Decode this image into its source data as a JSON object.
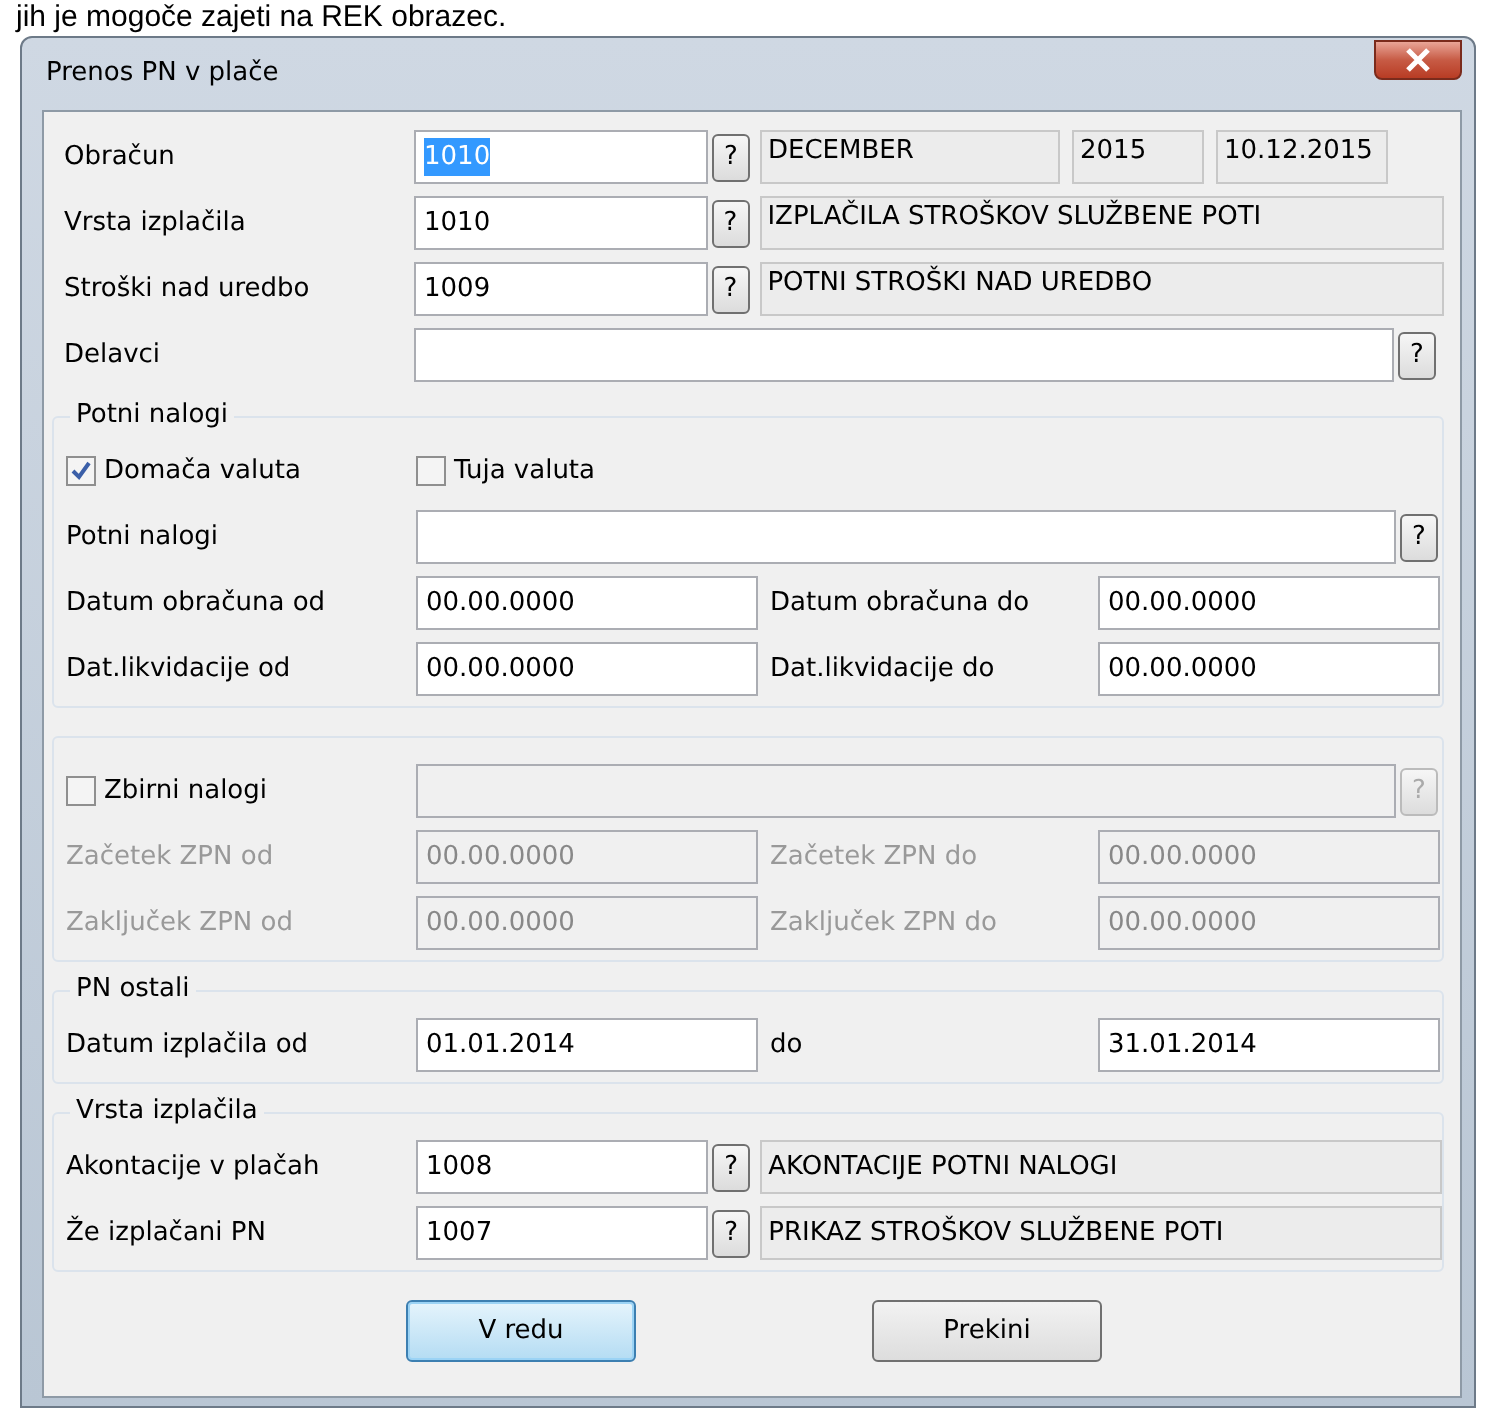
{
  "page_text": "jih je mogoče zajeti na REK obrazec.",
  "window": {
    "title": "Prenos PN v plače"
  },
  "main_rows": [
    {
      "label": "Obračun",
      "value": "1010",
      "value_selected": true,
      "lookup_button": "?",
      "infos": [
        "DECEMBER",
        "2015",
        "10.12.2015"
      ]
    },
    {
      "label": "Vrsta izplačila",
      "value": "1010",
      "value_selected": false,
      "lookup_button": "?",
      "infos": [
        "IZPLAČILA STROŠKOV SLUŽBENE POTI"
      ]
    },
    {
      "label": "Stroški nad uredbo",
      "value": "1009",
      "value_selected": false,
      "lookup_button": "?",
      "infos": [
        "POTNI STROŠKI NAD UREDBO"
      ]
    },
    {
      "label": "Delavci",
      "lookup_button": "?"
    }
  ],
  "potni_nalogi": {
    "title": "Potni nalogi",
    "checkboxes": [
      {
        "label": "Domača valuta",
        "checked": true
      },
      {
        "label": "Tuja valuta",
        "checked": false
      }
    ],
    "lookup": {
      "label": "Potni nalogi",
      "lookup_button": "?"
    },
    "date_rows": [
      {
        "label_from": "Datum obračuna od",
        "from": "00.00.0000",
        "label_to": "Datum obračuna do",
        "to": "00.00.0000"
      },
      {
        "label_from": "Dat.likvidacije od",
        "from": "00.00.0000",
        "label_to": "Dat.likvidacije do",
        "to": "00.00.0000"
      }
    ]
  },
  "zbirni_nalogi": {
    "checkbox": {
      "label": "Zbirni nalogi",
      "checked": false
    },
    "disabled": true,
    "lookup_button": "?",
    "date_rows": [
      {
        "label_from": "Začetek  ZPN od",
        "from": "00.00.0000",
        "label_to": "Začetek  ZPN do",
        "to": "00.00.0000"
      },
      {
        "label_from": "Zaključek ZPN od",
        "from": "00.00.0000",
        "label_to": "Zaključek ZPN do",
        "to": "00.00.0000"
      }
    ]
  },
  "pn_ostali": {
    "title": "PN ostali",
    "date_rows": [
      {
        "label_from": "Datum izplačila od",
        "from": "01.01.2014",
        "label_to": "do",
        "to": "31.01.2014"
      }
    ]
  },
  "vrsta_izplacila": {
    "title": "Vrsta izplačila",
    "rows": [
      {
        "label": "Akontacije v plačah",
        "value": "1008",
        "lookup_button": "?",
        "info": "AKONTACIJE POTNI NALOGI"
      },
      {
        "label": "Že izplačani PN",
        "value": "1007",
        "lookup_button": "?",
        "info": "PRIKAZ STROŠKOV SLUŽBENE POTI"
      }
    ]
  },
  "buttons": [
    {
      "label": "V redu",
      "default": true
    },
    {
      "label": "Prekini",
      "default": false
    }
  ]
}
